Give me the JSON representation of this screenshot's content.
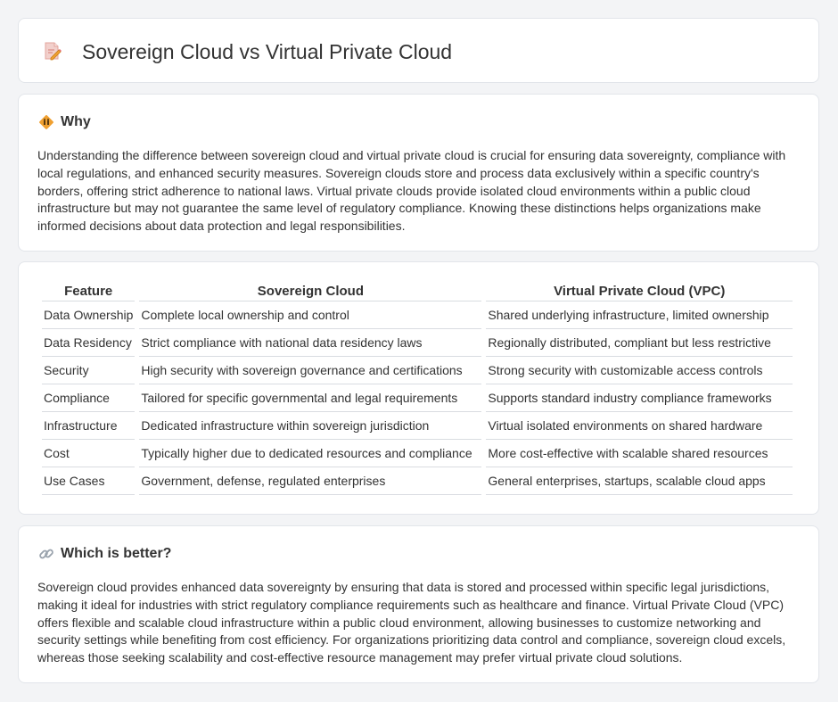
{
  "header": {
    "title": "Sovereign Cloud vs Virtual Private Cloud",
    "icon": "document-pencil-icon"
  },
  "why": {
    "icon": "diamond-sign-icon",
    "title": "Why",
    "text": "Understanding the difference between sovereign cloud and virtual private cloud is crucial for ensuring data sovereignty, compliance with local regulations, and enhanced security measures. Sovereign clouds store and process data exclusively within a specific country's borders, offering strict adherence to national laws. Virtual private clouds provide isolated cloud environments within a public cloud infrastructure but may not guarantee the same level of regulatory compliance. Knowing these distinctions helps organizations make informed decisions about data protection and legal responsibilities."
  },
  "table": {
    "headers": [
      "Feature",
      "Sovereign Cloud",
      "Virtual Private Cloud (VPC)"
    ],
    "rows": [
      [
        "Data Ownership",
        "Complete local ownership and control",
        "Shared underlying infrastructure, limited ownership"
      ],
      [
        "Data Residency",
        "Strict compliance with national data residency laws",
        "Regionally distributed, compliant but less restrictive"
      ],
      [
        "Security",
        "High security with sovereign governance and certifications",
        "Strong security with customizable access controls"
      ],
      [
        "Compliance",
        "Tailored for specific governmental and legal requirements",
        "Supports standard industry compliance frameworks"
      ],
      [
        "Infrastructure",
        "Dedicated infrastructure within sovereign jurisdiction",
        "Virtual isolated environments on shared hardware"
      ],
      [
        "Cost",
        "Typically higher due to dedicated resources and compliance",
        "More cost-effective with scalable shared resources"
      ],
      [
        "Use Cases",
        "Government, defense, regulated enterprises",
        "General enterprises, startups, scalable cloud apps"
      ]
    ]
  },
  "better": {
    "icon": "link-icon",
    "title": "Which is better?",
    "text": "Sovereign cloud provides enhanced data sovereignty by ensuring that data is stored and processed within specific legal jurisdictions, making it ideal for industries with strict regulatory compliance requirements such as healthcare and finance. Virtual Private Cloud (VPC) offers flexible and scalable cloud infrastructure within a public cloud environment, allowing businesses to customize networking and security settings while benefiting from cost efficiency. For organizations prioritizing data control and compliance, sovereign cloud excels, whereas those seeking scalability and cost-effective resource management may prefer virtual private cloud solutions."
  },
  "colors": {
    "background": "#f3f4f6",
    "card": "#ffffff",
    "text": "#333333",
    "icon_orange": "#f0a030",
    "icon_pink": "#e8707a"
  }
}
